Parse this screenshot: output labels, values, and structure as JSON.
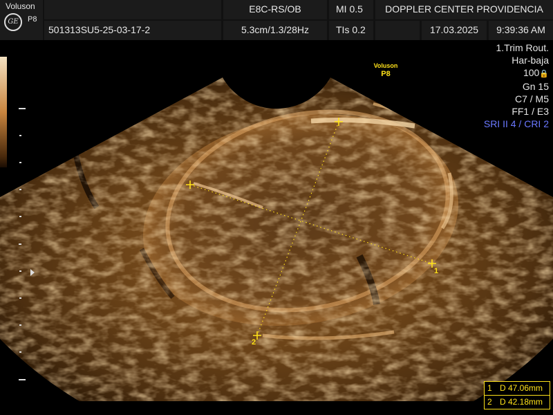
{
  "header": {
    "brand": "Voluson",
    "model": "P8",
    "logo": "GE",
    "patient_id": "501313SU5-25-03-17-2",
    "probe": "E8C-RS/OB",
    "depth_freq": "5.3cm/1.3/28Hz",
    "mi": "MI  0.5",
    "tis": "TIs  0.2",
    "institution": "DOPPLER CENTER PROVIDENCIA",
    "date": "17.03.2025",
    "time": "9:39:36 AM"
  },
  "probe_label": {
    "brand": "Voluson",
    "model": "P8"
  },
  "params": {
    "preset": "1.Trim Rout.",
    "mode": "Har-baja",
    "power": "100",
    "gain": "Gn  15",
    "cm": "C7 / M5",
    "ff": "FF1 / E3",
    "sri": "SRI II 4 / CRI 2"
  },
  "calipers": {
    "first": "1",
    "second": "2"
  },
  "measurements": [
    {
      "index": "1",
      "label": "D 47.06mm"
    },
    {
      "index": "2",
      "label": "D 42.18mm"
    }
  ],
  "colors": {
    "caliper": "#ffe21a",
    "accent": "#6a78ff",
    "tissue": "#c58a44"
  }
}
